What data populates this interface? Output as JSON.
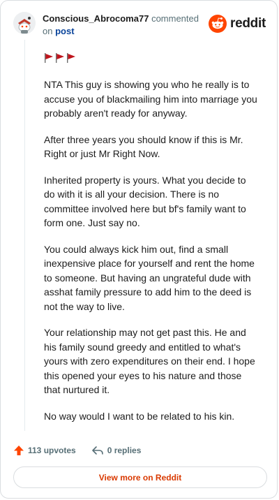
{
  "header": {
    "username": "Conscious_Abrocoma77",
    "action_text": "commented on",
    "post_link": "post",
    "brand_name": "reddit"
  },
  "comment": {
    "paragraphs": [
      "NTA This guy is showing you who he really is to accuse you of blackmailing him into marriage you probably aren't ready for anyway.",
      "After three years you should know if this is Mr. Right or just Mr Right Now.",
      "Inherited property is yours. What you decide to do with it is all your decision. There is no committee involved here but bf's family want to form one. Just say no.",
      "You could always kick him out, find a small inexpensive place for yourself and rent the home to someone. But having an ungrateful dude with asshat family pressure to add him to the deed is not the way to live.",
      "Your relationship may not get past this. He and his family sound greedy and entitled to what's yours with zero expenditures on their end. I hope this opened your eyes to his nature and those that nurtured it.",
      "No way would I want to be related to his kin."
    ]
  },
  "actions": {
    "upvotes": "113 upvotes",
    "replies": "0 replies"
  },
  "footer": {
    "view_more": "View more on Reddit"
  },
  "colors": {
    "brand": "#ff4500",
    "link": "#0a449b",
    "flag_red": "#c0151d",
    "view_more_text": "#d93900"
  }
}
